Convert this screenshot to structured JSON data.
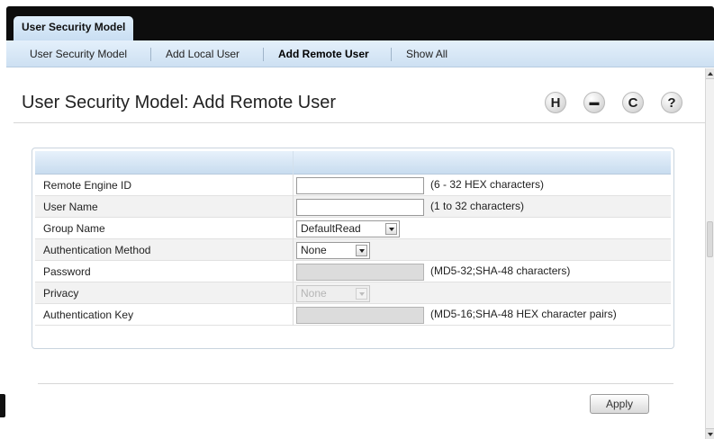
{
  "top_tab": {
    "label": "User Security Model"
  },
  "subnav": {
    "items": [
      {
        "label": "User Security Model"
      },
      {
        "label": "Add Local User"
      },
      {
        "label": "Add Remote User"
      },
      {
        "label": "Show All"
      }
    ],
    "active": "Add Remote User"
  },
  "page": {
    "title": "User Security Model: Add Remote User"
  },
  "toolbar": {
    "save_icon": "save-icon",
    "print_icon": "print-icon",
    "refresh_icon": "refresh-icon",
    "help_icon": "help-icon",
    "save_glyph": "H",
    "print_glyph": "▬",
    "refresh_glyph": "C",
    "help_glyph": "?"
  },
  "form": {
    "rows": [
      {
        "label": "Remote Engine ID",
        "value": "",
        "hint": "(6 - 32 HEX characters)"
      },
      {
        "label": "User Name",
        "value": "",
        "hint": "(1 to 32 characters)"
      },
      {
        "label": "Group Name",
        "selected": "DefaultRead"
      },
      {
        "label": "Authentication Method",
        "selected": "None"
      },
      {
        "label": "Password",
        "value": "",
        "hint": "(MD5-32;SHA-48 characters)"
      },
      {
        "label": "Privacy",
        "selected": "None"
      },
      {
        "label": "Authentication Key",
        "value": "",
        "hint": "(MD5-16;SHA-48 HEX character pairs)"
      }
    ]
  },
  "actions": {
    "apply_label": "Apply"
  },
  "colors": {
    "topbar": "#0d0d0d",
    "tab_bg": "#d4e6f7",
    "header_bg": "#d6e6f5",
    "disabled_field": "#dcdcdc"
  }
}
